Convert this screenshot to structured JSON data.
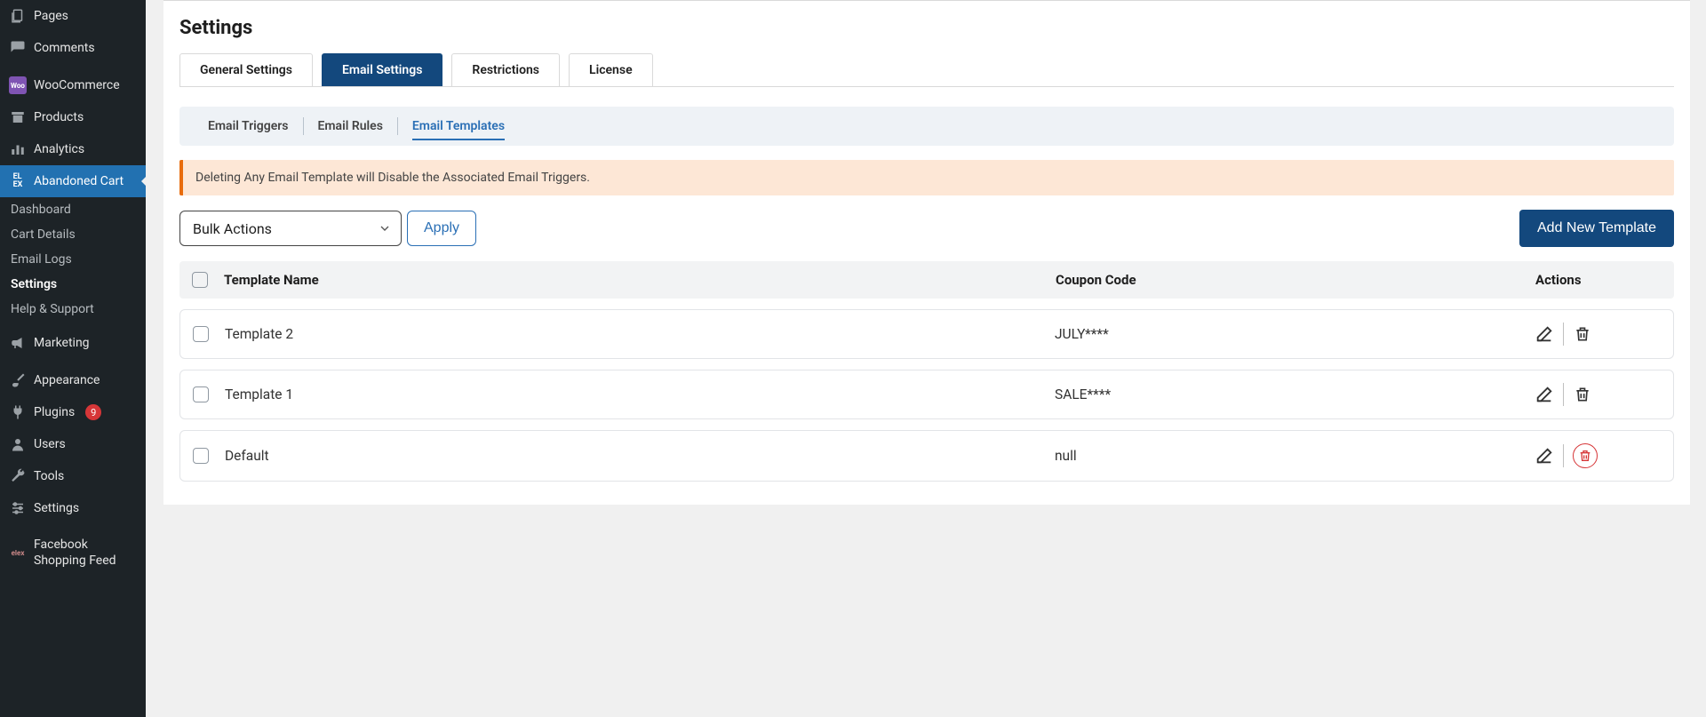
{
  "sidebar": {
    "items": [
      {
        "label": "Pages",
        "icon": "pages"
      },
      {
        "label": "Comments",
        "icon": "comment"
      },
      {
        "label": "WooCommerce",
        "icon": "woo"
      },
      {
        "label": "Products",
        "icon": "archive"
      },
      {
        "label": "Analytics",
        "icon": "bars"
      },
      {
        "label": "Abandoned Cart",
        "icon": "elex",
        "active": true
      },
      {
        "label": "Marketing",
        "icon": "megaphone"
      },
      {
        "label": "Appearance",
        "icon": "brush"
      },
      {
        "label": "Plugins",
        "icon": "plug",
        "badge": "9"
      },
      {
        "label": "Users",
        "icon": "user"
      },
      {
        "label": "Tools",
        "icon": "wrench"
      },
      {
        "label": "Settings",
        "icon": "sliders"
      },
      {
        "label": "Facebook Shopping Feed",
        "icon": "elex2"
      }
    ],
    "submenu": [
      {
        "label": "Dashboard"
      },
      {
        "label": "Cart Details"
      },
      {
        "label": "Email Logs"
      },
      {
        "label": "Settings",
        "current": true
      },
      {
        "label": "Help & Support"
      }
    ]
  },
  "page": {
    "title": "Settings"
  },
  "tabs": [
    {
      "label": "General Settings"
    },
    {
      "label": "Email Settings",
      "active": true
    },
    {
      "label": "Restrictions"
    },
    {
      "label": "License"
    }
  ],
  "subtabs": [
    {
      "label": "Email Triggers"
    },
    {
      "label": "Email Rules"
    },
    {
      "label": "Email Templates",
      "active": true
    }
  ],
  "notice": {
    "text": "Deleting Any Email Template will Disable the Associated Email Triggers."
  },
  "bulk": {
    "select_label": "Bulk Actions",
    "apply_label": "Apply"
  },
  "buttons": {
    "add_new": "Add New Template"
  },
  "table": {
    "headers": {
      "name": "Template Name",
      "coupon": "Coupon Code",
      "actions": "Actions"
    },
    "rows": [
      {
        "name": "Template 2",
        "coupon": "JULY****",
        "delete_danger": false
      },
      {
        "name": "Template 1",
        "coupon": "SALE****",
        "delete_danger": false
      },
      {
        "name": "Default",
        "coupon": "null",
        "delete_danger": true
      }
    ]
  }
}
